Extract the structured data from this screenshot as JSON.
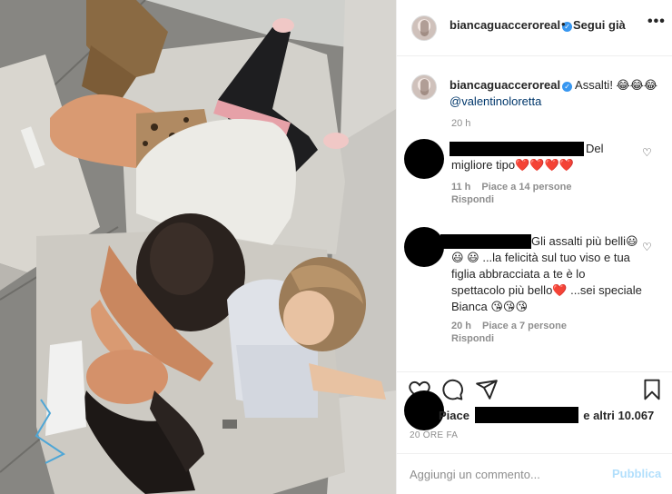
{
  "header": {
    "username": "biancaguacceroreal",
    "separator": "•",
    "follow_label": "Segui già",
    "more": "•••"
  },
  "caption": {
    "username": "biancaguacceroreal",
    "text": "Assalti! 😂😂😂",
    "mention": "@valentinoloretta",
    "time": "20 h"
  },
  "comments": [
    {
      "text": "Del migliore tipo❤️❤️❤️❤️",
      "time": "11 h",
      "likes": "Piace a 14 persone",
      "reply": "Rispondi"
    },
    {
      "text": "Gli assalti più belli😃 😃 😃 ...la felicità sul tuo viso e tua figlia abbracciata a te è lo spettacolo più bello❤️ ...sei speciale Bianca 😘😘😘",
      "time": "20 h",
      "likes": "Piace a 7 persone",
      "reply": "Rispondi"
    }
  ],
  "likes": {
    "prefix": "Piace",
    "suffix": "e altri 10.067"
  },
  "time_ago": "20 ORE FA",
  "add_comment": {
    "placeholder": "Aggiungi un commento...",
    "publish_label": "Pubblica"
  },
  "colors": {
    "link": "#00376b",
    "verified": "#3897f0",
    "publish_disabled": "#b2dffc",
    "muted": "#8e8e8e"
  },
  "icons": [
    "heart-icon",
    "comment-icon",
    "share-icon",
    "bookmark-icon",
    "verified-badge-icon",
    "more-options-icon"
  ]
}
